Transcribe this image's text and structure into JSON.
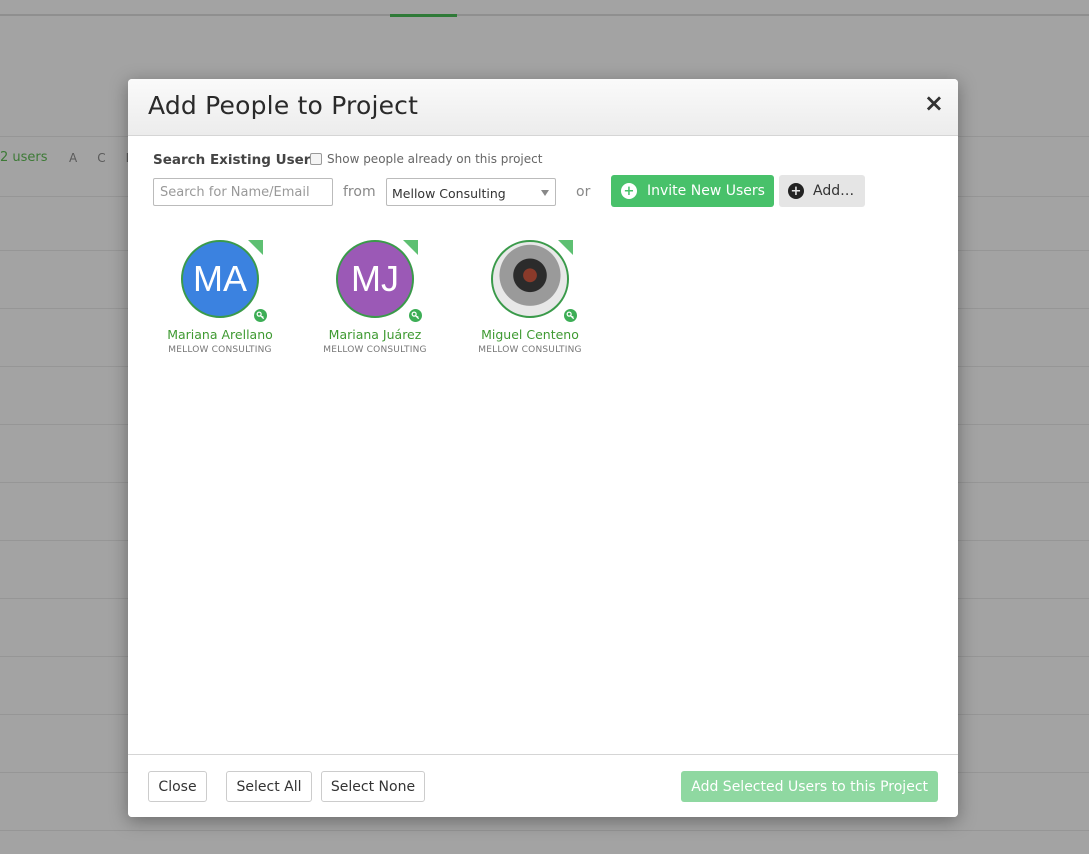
{
  "background": {
    "users_count_label": "2 users",
    "letters": [
      "A",
      "C",
      "D"
    ]
  },
  "modal": {
    "title": "Add People to Project",
    "close_glyph": "×",
    "search_label": "Search Existing Users",
    "show_existing_label": "Show people already on this project",
    "search_placeholder": "Search for Name/Email",
    "search_value": "",
    "from_label": "from",
    "company_selected": "Mellow Consulting",
    "or_label": "or",
    "invite_button": "Invite New Users",
    "add_button": "Add…"
  },
  "users": [
    {
      "name": "Mariana Arellano",
      "org": "MELLOW CONSULTING",
      "initials": "MA",
      "avatar_color": "#3b82e0",
      "icon": "key-icon"
    },
    {
      "name": "Mariana Juárez",
      "org": "MELLOW CONSULTING",
      "initials": "MJ",
      "avatar_color": "#9b59b6",
      "icon": "key-icon"
    },
    {
      "name": "Miguel Centeno",
      "org": "MELLOW CONSULTING",
      "initials": "",
      "avatar_color": "#2d2d2d",
      "icon": "key-icon"
    }
  ],
  "footer": {
    "close_button": "Close",
    "select_all_button": "Select All",
    "select_none_button": "Select None",
    "add_selected_button": "Add Selected Users to this Project"
  },
  "colors": {
    "accent_green": "#48c16a",
    "name_green": "#3f9a32",
    "disabled_green": "#8fd8a1"
  }
}
